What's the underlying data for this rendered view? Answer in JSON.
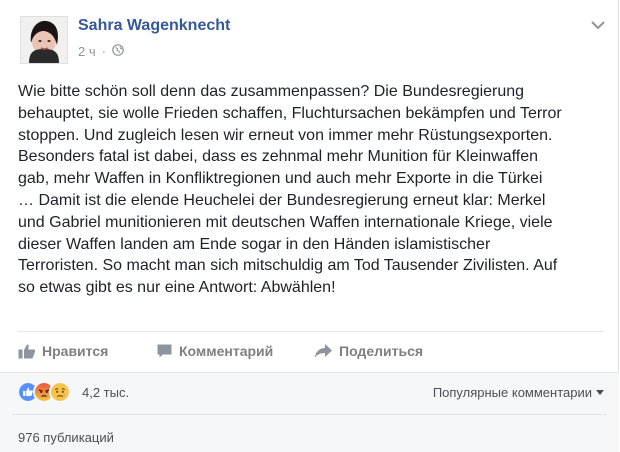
{
  "post": {
    "author": "Sahra Wagenknecht",
    "time": "2 ч",
    "separator": "·",
    "privacy_icon": "globe-icon",
    "text": "Wie bitte schön soll denn das zusammenpassen? Die Bundesregierung\nbehauptet, sie wolle Frieden schaffen, Fluchtursachen bekämpfen und Terror\nstoppen. Und zugleich lesen wir erneut von immer mehr Rüstungsexporten.\nBesonders fatal ist dabei, dass es zehnmal mehr Munition für Kleinwaffen\ngab, mehr Waffen in Konfliktregionen und auch mehr Exporte in die Türkei\n… Damit ist die elende Heuchelei der Bundesregierung erneut klar: Merkel\nund Gabriel munitionieren mit deutschen Waffen internationale Kriege, viele\ndieser Waffen landen am Ende sogar in den Händen islamistischer\nTerroristen. So macht man sich mitschuldig am Tod Tausender Zivilisten. Auf\nso etwas gibt es nur eine Antwort: Abwählen!"
  },
  "actions": {
    "like": "Нравится",
    "comment": "Комментарий",
    "share": "Поделиться"
  },
  "footer": {
    "reactions": [
      "like",
      "angry",
      "sad"
    ],
    "reaction_count": "4,2 тыс.",
    "sort_label": "Популярные комментарии",
    "shares": "976 публикаций"
  },
  "colors": {
    "author_link": "#365899",
    "like_blue": "#5890ff",
    "angry_red": "#e9573e",
    "sad_yellow": "#f7c34a"
  }
}
